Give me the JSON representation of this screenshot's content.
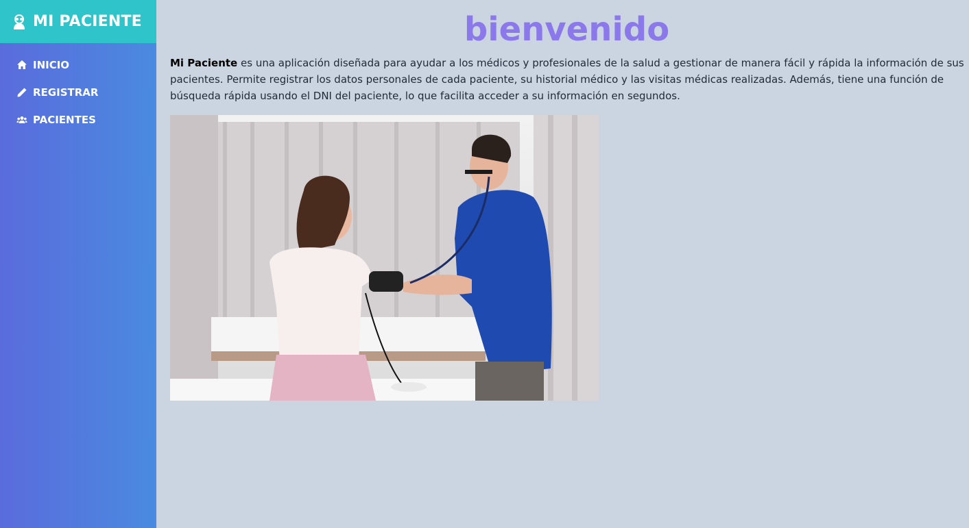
{
  "brand": {
    "name": "MI PACIENTE",
    "icon": "doctor-icon"
  },
  "nav": {
    "items": [
      {
        "label": "INICIO",
        "icon": "home-icon"
      },
      {
        "label": "REGISTRAR",
        "icon": "pencil-icon"
      },
      {
        "label": "PACIENTES",
        "icon": "users-icon"
      }
    ]
  },
  "main": {
    "title": "bienvenido",
    "intro_bold": "Mi Paciente",
    "intro_text": " es una aplicación diseñada para ayudar a los médicos y profesionales de la salud a gestionar de manera fácil y rápida la información de sus pacientes. Permite registrar los datos personales de cada paciente, su historial médico y las visitas médicas realizadas. Además, tiene una función de búsqueda rápida usando el DNI del paciente, lo que facilita acceder a su información en segundos."
  },
  "colors": {
    "brand_bg": "#2ec4c9",
    "title": "#8b79ec",
    "page_bg": "#cbd5e1"
  }
}
